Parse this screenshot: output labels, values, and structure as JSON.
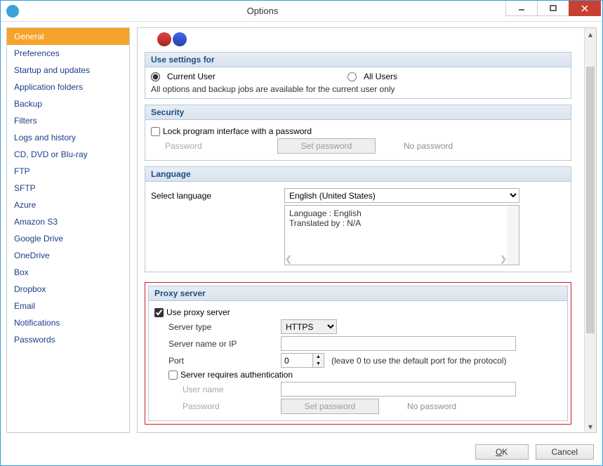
{
  "window": {
    "title": "Options"
  },
  "sidebar": {
    "items": [
      "General",
      "Preferences",
      "Startup and updates",
      "Application folders",
      "Backup",
      "Filters",
      "Logs and history",
      "CD, DVD or Blu-ray",
      "FTP",
      "SFTP",
      "Azure",
      "Amazon S3",
      "Google Drive",
      "OneDrive",
      "Box",
      "Dropbox",
      "Email",
      "Notifications",
      "Passwords"
    ],
    "active_index": 0
  },
  "sections": {
    "use_settings": {
      "title": "Use settings for",
      "current_user": "Current User",
      "all_users": "All Users",
      "note": "All options and backup jobs are available for the current user only",
      "selected": "current_user"
    },
    "security": {
      "title": "Security",
      "lock_label": "Lock program interface with a password",
      "lock_checked": false,
      "password_label": "Password",
      "set_password": "Set password",
      "no_password": "No password"
    },
    "language": {
      "title": "Language",
      "select_label": "Select language",
      "selected": "English (United States)",
      "info_line1": "Language : English",
      "info_line2": "Translated by : N/A"
    },
    "proxy": {
      "title": "Proxy server",
      "use_label": "Use proxy server",
      "use_checked": true,
      "server_type_label": "Server type",
      "server_type": "HTTPS",
      "server_name_label": "Server name or IP",
      "server_name": "",
      "port_label": "Port",
      "port": "0",
      "port_hint": "(leave 0 to use the default port for the protocol)",
      "auth_label": "Server requires authentication",
      "auth_checked": false,
      "user_label": "User name",
      "user": "",
      "password_label": "Password",
      "set_password": "Set password",
      "no_password": "No password"
    }
  },
  "footer": {
    "ok": "OK",
    "cancel": "Cancel"
  }
}
